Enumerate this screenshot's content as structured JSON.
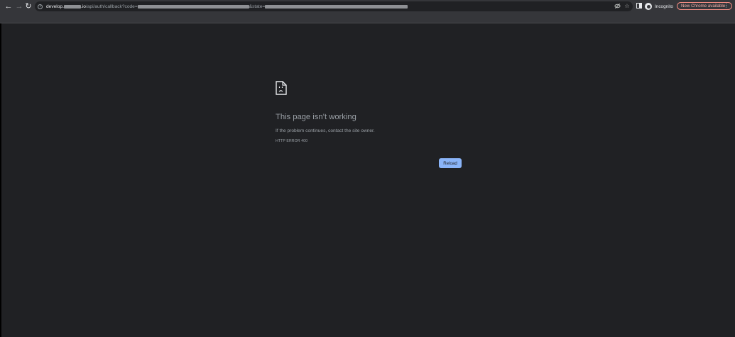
{
  "browser": {
    "nav": {
      "back_glyph": "←",
      "forward_glyph": "→",
      "reload_glyph": "↻"
    },
    "address_bar": {
      "host_prefix": "develop.",
      "host_suffix": ".io",
      "path": "/api/auth/callback?code=",
      "state_param": "&state="
    },
    "profile_label": "Incognito",
    "update_label": "New Chrome available"
  },
  "error_page": {
    "title": "This page isn’t working",
    "description": "If the problem continues, contact the site owner.",
    "error_code": "HTTP ERROR 400",
    "reload_label": "Reload"
  },
  "colors": {
    "background": "#202124",
    "toolbar": "#35363a",
    "accent_button": "#8ab4f8",
    "update_pill_border": "#f28b82"
  }
}
